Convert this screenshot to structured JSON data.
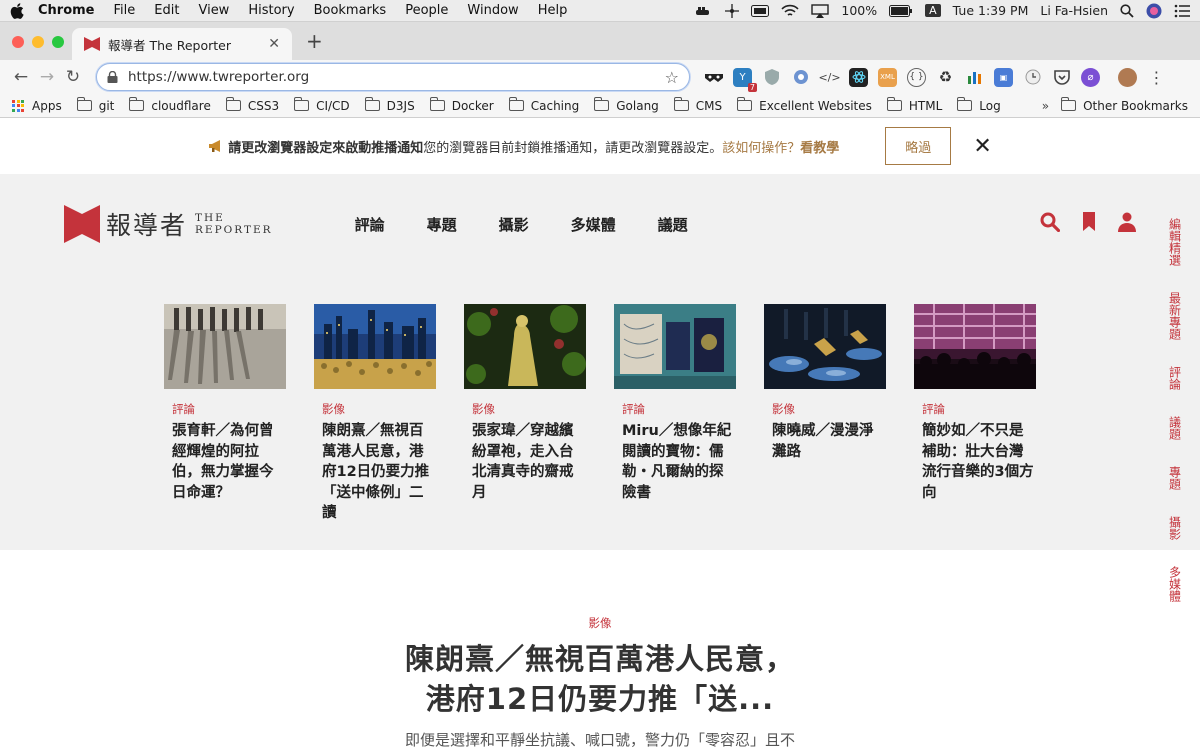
{
  "menubar": {
    "app": "Chrome",
    "items": [
      "File",
      "Edit",
      "View",
      "History",
      "Bookmarks",
      "People",
      "Window",
      "Help"
    ],
    "battery": "100%",
    "input_source": "A",
    "clock": "Tue 1:39 PM",
    "user": "Li Fa-Hsien"
  },
  "browser": {
    "tab_title": "報導者 The Reporter",
    "url": "https://www.twreporter.org",
    "extension_badge": "7"
  },
  "bookmarks": {
    "items": [
      "Apps",
      "git",
      "cloudflare",
      "CSS3",
      "CI/CD",
      "D3JS",
      "Docker",
      "Caching",
      "Golang",
      "CMS",
      "Excellent Websites",
      "HTML",
      "Log"
    ],
    "more": "»",
    "other": "Other Bookmarks"
  },
  "notice": {
    "icon": "megaphone-icon",
    "bold": "請更改瀏覽器設定來啟動推播通知",
    "normal": "您的瀏覽器目前封鎖推播通知，請更改瀏覽器設定。",
    "link": "該如何操作？",
    "link_bold": "看教學",
    "skip": "略過",
    "close": "✕"
  },
  "site": {
    "logo_zh": "報導者",
    "logo_en_1": "THE",
    "logo_en_2": "REPORTER",
    "nav": [
      "評論",
      "專題",
      "攝影",
      "多媒體",
      "議題"
    ],
    "accent": "#c4333b",
    "cards": [
      {
        "category": "評論",
        "title": "張育軒／為何曾經輝煌的阿拉伯，無力掌握今日命運？"
      },
      {
        "category": "影像",
        "title": "陳朗熹／無視百萬港人民意，港府12日仍要力推「送中條例」二讀"
      },
      {
        "category": "影像",
        "title": "張家瑋／穿越繽紛罩袍，走入台北清真寺的齋戒月"
      },
      {
        "category": "評論",
        "title": "Miru／想像年紀閱讀的寶物：儒勒・凡爾納的探險書"
      },
      {
        "category": "影像",
        "title": "陳曉威／漫漫淨灘路"
      },
      {
        "category": "評論",
        "title": "簡妙如／不只是補助：壯大台灣流行音樂的3個方向"
      }
    ],
    "rail": [
      "編輯精選",
      "最新專題",
      "評論",
      "議題",
      "專題",
      "攝影",
      "多媒體"
    ]
  },
  "featured": {
    "category": "影像",
    "title_line1": "陳朗熹／無視百萬港人民意，",
    "title_line2": "港府12日仍要力推「送...",
    "lead": "即便是選擇和平靜坐抗議、喊口號，警力仍「零容忍」且不"
  }
}
